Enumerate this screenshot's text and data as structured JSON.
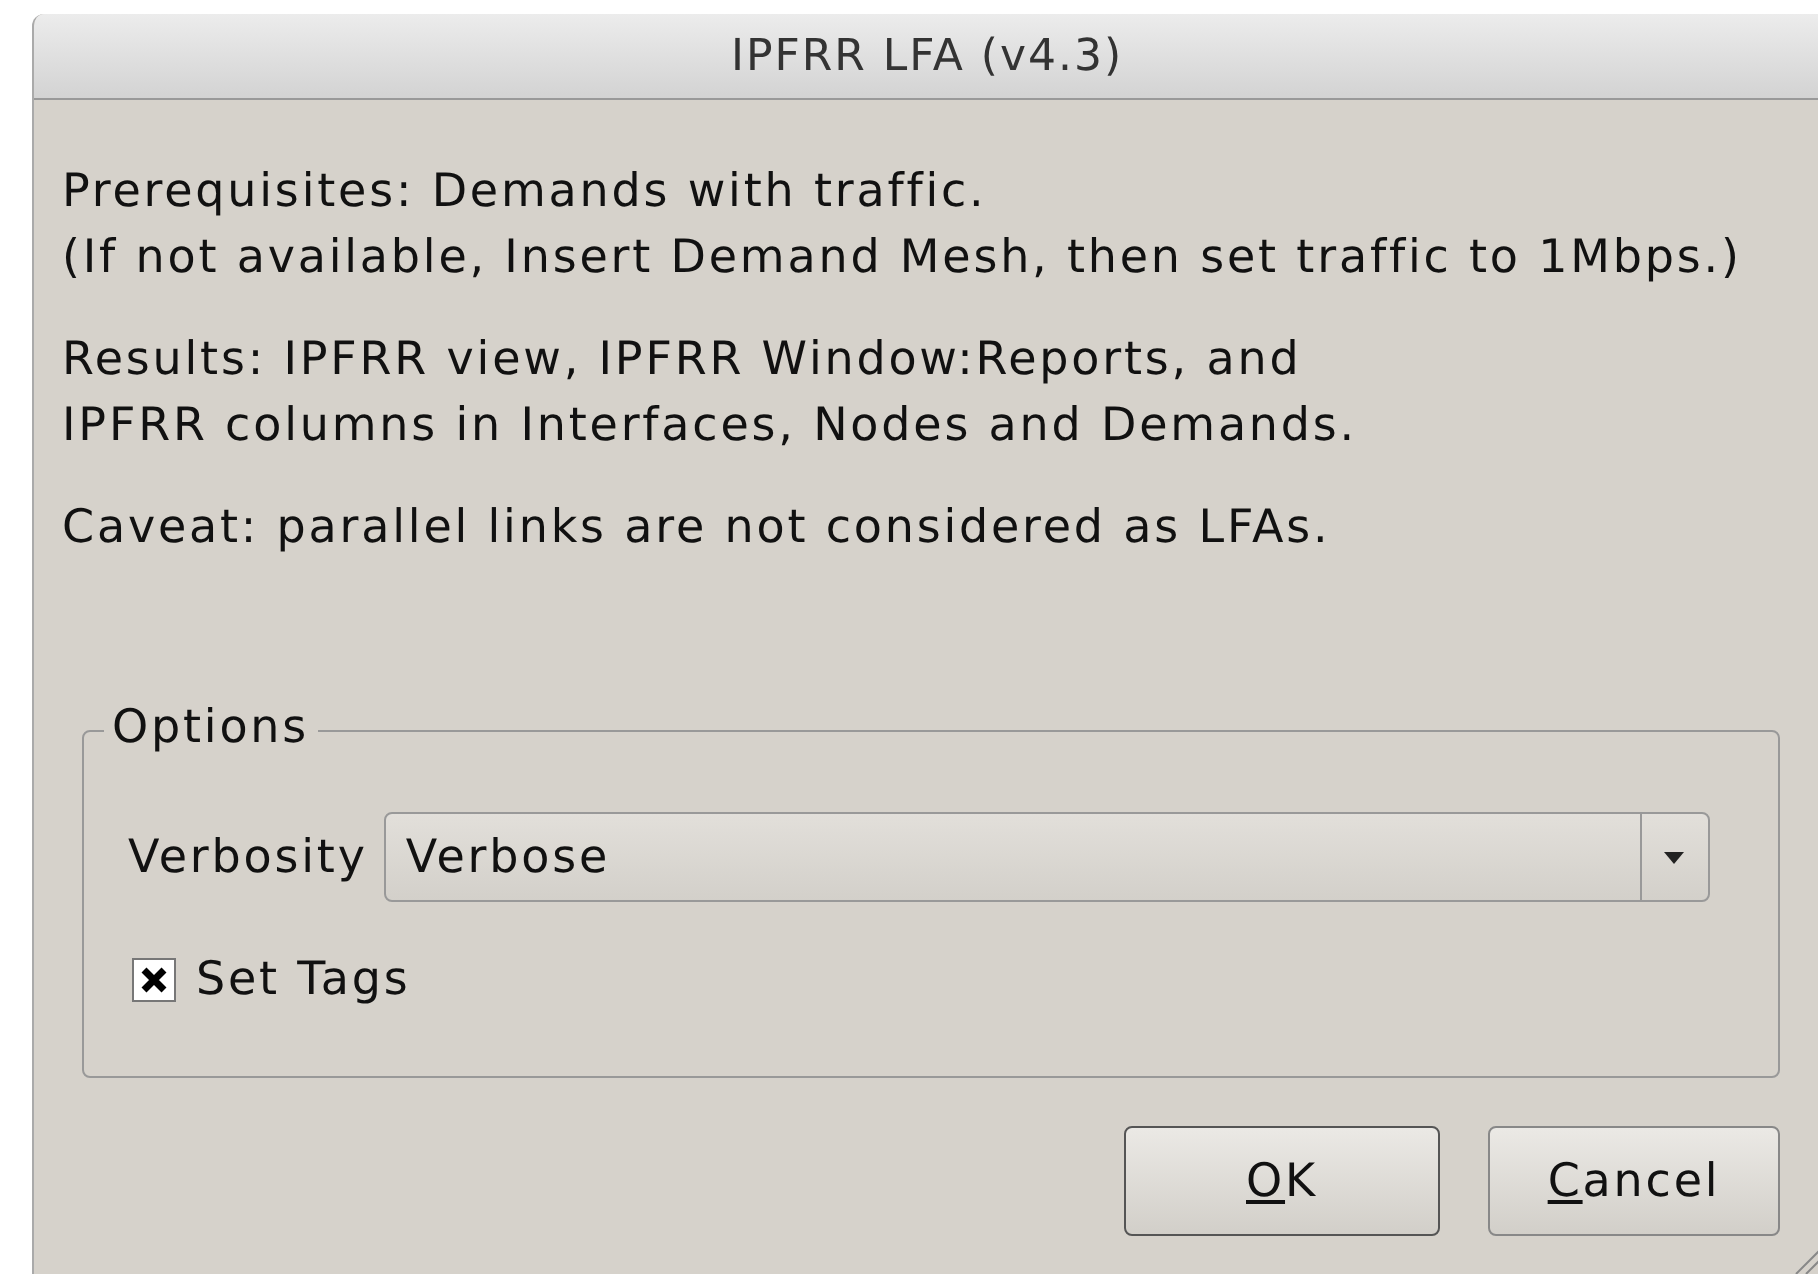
{
  "window": {
    "title": "IPFRR LFA (v4.3)"
  },
  "paragraphs": [
    {
      "lines": [
        "Prerequisites: Demands with traffic.",
        "(If not available, Insert Demand Mesh, then set traffic to 1Mbps.)"
      ]
    },
    {
      "lines": [
        "Results: IPFRR view, IPFRR Window:Reports, and",
        "IPFRR columns in Interfaces, Nodes and Demands."
      ]
    },
    {
      "lines": [
        "Caveat: parallel links are not considered as LFAs."
      ]
    }
  ],
  "options": {
    "legend": "Options",
    "verbosity": {
      "label": "Verbosity",
      "value": "Verbose"
    },
    "set_tags": {
      "label": "Set Tags",
      "checked": true
    }
  },
  "buttons": [
    {
      "underlined": "O",
      "rest": "K",
      "default": true
    },
    {
      "underlined": "C",
      "rest": "ancel",
      "default": false
    }
  ]
}
